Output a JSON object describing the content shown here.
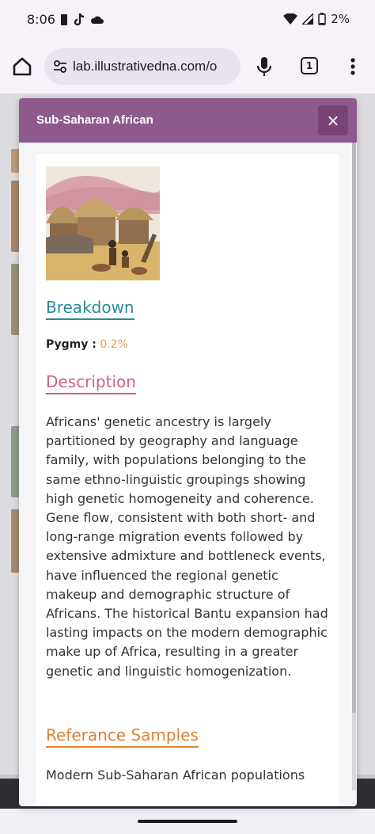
{
  "status_bar": {
    "time": "8:06",
    "battery": "2%",
    "icons": [
      "sim-icon",
      "tiktok-icon",
      "cloud-icon",
      "wifi-icon",
      "signal-icon",
      "battery-icon"
    ]
  },
  "browser": {
    "url": "lab.illustrativedna.com/o",
    "tab_count": "1",
    "icons": [
      "home-icon",
      "site-settings-icon",
      "mic-icon",
      "tabs-icon",
      "more-menu-icon"
    ]
  },
  "modal": {
    "title": "Sub-Saharan African",
    "close_label": "×",
    "image_alt": "illustration of a village with thatched huts and people",
    "breakdown_heading": "Breakdown",
    "breakdown": [
      {
        "label": "Pygmy :",
        "value": "0.2%"
      }
    ],
    "description_heading": "Description",
    "description": "Africans' genetic ancestry is largely partitioned by geography and language family, with populations belonging to the same ethno-linguistic groupings showing high genetic homogeneity and coherence. Gene flow, consistent with both short- and long-range migration events followed by extensive admixture and bottleneck events, have influenced the regional genetic makeup and demographic structure of Africans. The historical Bantu expansion had lasting impacts on the modern demographic make up of Africa, resulting in a greater genetic and linguistic homogenization.",
    "reference_heading": "Referance Samples",
    "reference_text": "Modern Sub-Saharan African populations"
  },
  "colors": {
    "header": "#8e5a8e",
    "breakdown": "#2b8a94",
    "description": "#d0607a",
    "reference": "#dd8233",
    "percent": "#d9a24a"
  }
}
